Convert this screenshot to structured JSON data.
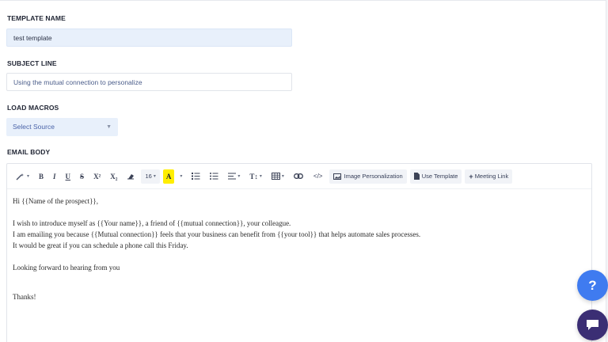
{
  "template_name": {
    "label": "TEMPLATE NAME",
    "value": "test template"
  },
  "subject_line": {
    "label": "SUBJECT LINE",
    "value": "Using the mutual connection to personalize"
  },
  "load_macros": {
    "label": "LOAD MACROS",
    "select_value": "Select Source"
  },
  "email_body": {
    "label": "EMAIL BODY",
    "toolbar": {
      "magic": "magic-wand-icon",
      "bold": "B",
      "italic": "I",
      "underline": "U",
      "strike": "S",
      "superscript": "X²",
      "subscript": "X₂",
      "eraser": "eraser-icon",
      "font_size": "16",
      "highlight": "A",
      "ordered_list": "ordered-list-icon",
      "unordered_list": "unordered-list-icon",
      "align": "align-icon",
      "text_height": "T↕",
      "table": "table-icon",
      "link": "link-icon",
      "code": "</>",
      "image_personalization": "Image Personalization",
      "use_template": "Use Template",
      "meeting_link": "Meeting Link"
    },
    "lines": [
      "Hi {{Name of the prospect}},",
      "",
      "I wish to introduce myself as {{Your name}}, a friend of {{mutual connection}}, your colleague.",
      "I am emailing you because {{Mutual connection}} feels that your business can benefit from {{your tool}} that helps automate sales processes.",
      "It would be great if you can schedule a phone call this Friday.",
      "",
      "Looking forward to hearing from you",
      "",
      "Thanks!"
    ]
  },
  "help_button": "?",
  "colors": {
    "accent": "#3f7bf0",
    "chat": "#3b2e74",
    "field_bg": "#e8f0fb",
    "highlight": "#ffee00"
  }
}
